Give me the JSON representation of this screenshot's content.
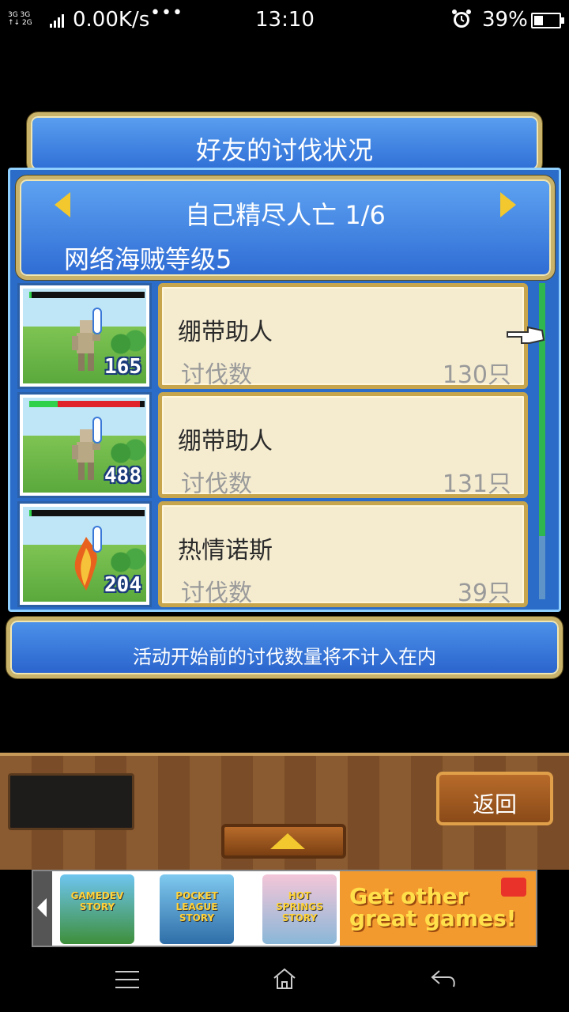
{
  "status_bar": {
    "network_line1": "3G 3G",
    "network_line2": "↑↓ 2G",
    "speed": "0.00K/s",
    "more": "•••",
    "time": "13:10",
    "battery_percent": "39%"
  },
  "title": "好友的讨伐状况",
  "header": {
    "name": "自己精尽人亡 1/6",
    "level": "网络海贼等级5"
  },
  "list": [
    {
      "monster": "绷带助人",
      "label": "讨伐数",
      "count": "130只",
      "level_badge": "165",
      "hp_fraction": 0.02,
      "damage_fraction": 0.0
    },
    {
      "monster": "绷带助人",
      "label": "讨伐数",
      "count": "131只",
      "level_badge": "488",
      "hp_fraction": 0.25,
      "damage_fraction": 0.72
    },
    {
      "monster": "热情诺斯",
      "label": "讨伐数",
      "count": "39只",
      "level_badge": "204",
      "hp_fraction": 0.02,
      "damage_fraction": 0.0
    }
  ],
  "note": "活动开始前的讨伐数量将不计入在内",
  "buttons": {
    "back": "返回"
  },
  "ad": {
    "game1": "GAMEDEV STORY",
    "game2": "POCKET LEAGUE STORY",
    "game3": "HOT SPRINGS STORY",
    "cta_line1": "Get other",
    "cta_line2": "great games!"
  },
  "colors": {
    "panel_blue": "#2f6fd6",
    "gold_border": "#c9b26a",
    "card_bg": "#f5ecd0",
    "hp_green": "#2fd04a",
    "hp_red": "#e0232a"
  }
}
